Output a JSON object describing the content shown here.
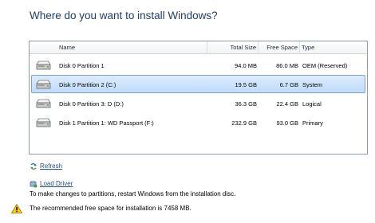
{
  "title": "Where do you want to install Windows?",
  "columns": {
    "name": "Name",
    "total": "Total Size",
    "free": "Free Space",
    "type": "Type"
  },
  "rows": [
    {
      "name": "Disk 0 Partition 1",
      "total": "94.0 MB",
      "free": "86.0 MB",
      "type": "OEM (Reserved)",
      "selected": false
    },
    {
      "name": "Disk 0 Partition 2 (C:)",
      "total": "19.5 GB",
      "free": "6.7 GB",
      "type": "System",
      "selected": true
    },
    {
      "name": "Disk 0 Partition 3: D (D:)",
      "total": "36.3 GB",
      "free": "22.4 GB",
      "type": "Logical",
      "selected": false
    },
    {
      "name": "Disk 1 Partition 1: WD Passport (F:)",
      "total": "232.9 GB",
      "free": "93.0 GB",
      "type": "Primary",
      "selected": false
    }
  ],
  "links": {
    "refresh": "Refresh",
    "load_driver": "Load Driver"
  },
  "messages": {
    "restart": "To make changes to partitions, restart Windows from the installation disc.",
    "warning": "The recommended free space for installation is 7458 MB."
  },
  "icons": {
    "drive": "hard-drive-icon",
    "refresh": "refresh-icon",
    "load_driver": "load-driver-icon",
    "warning": "warning-icon"
  },
  "colors": {
    "selection": "#c1dcfc",
    "selection_border": "#7da2ce",
    "title": "#1f3e66",
    "link": "#1e4f8f"
  }
}
